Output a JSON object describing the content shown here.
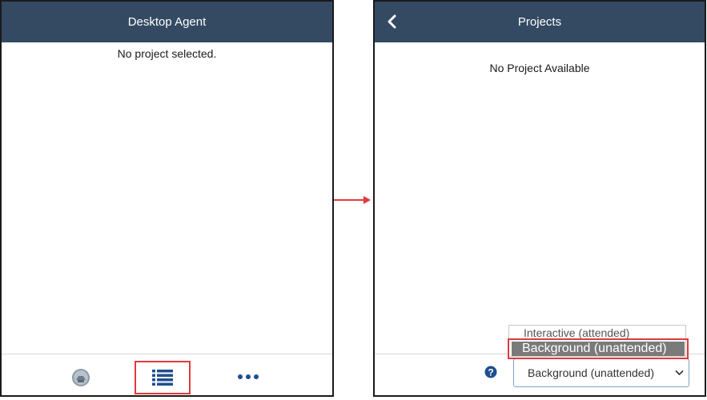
{
  "left_panel": {
    "title": "Desktop Agent",
    "message": "No project selected.",
    "footer": {
      "agent_icon": "agent-avatar-icon",
      "list_icon": "list-icon",
      "more_icon": "more-icon"
    }
  },
  "right_panel": {
    "title": "Projects",
    "back_icon": "chevron-left-icon",
    "message": "No Project Available",
    "help_icon": "help-icon",
    "mode_select": {
      "value": "Background (unattended)",
      "options": [
        "Interactive (attended)",
        "Background (unattended)"
      ]
    }
  },
  "colors": {
    "header_bg": "#344a63",
    "highlight": "#e03b3b",
    "icon_blue": "#1f4f8f",
    "selected_option_bg": "#7a7a7a"
  }
}
